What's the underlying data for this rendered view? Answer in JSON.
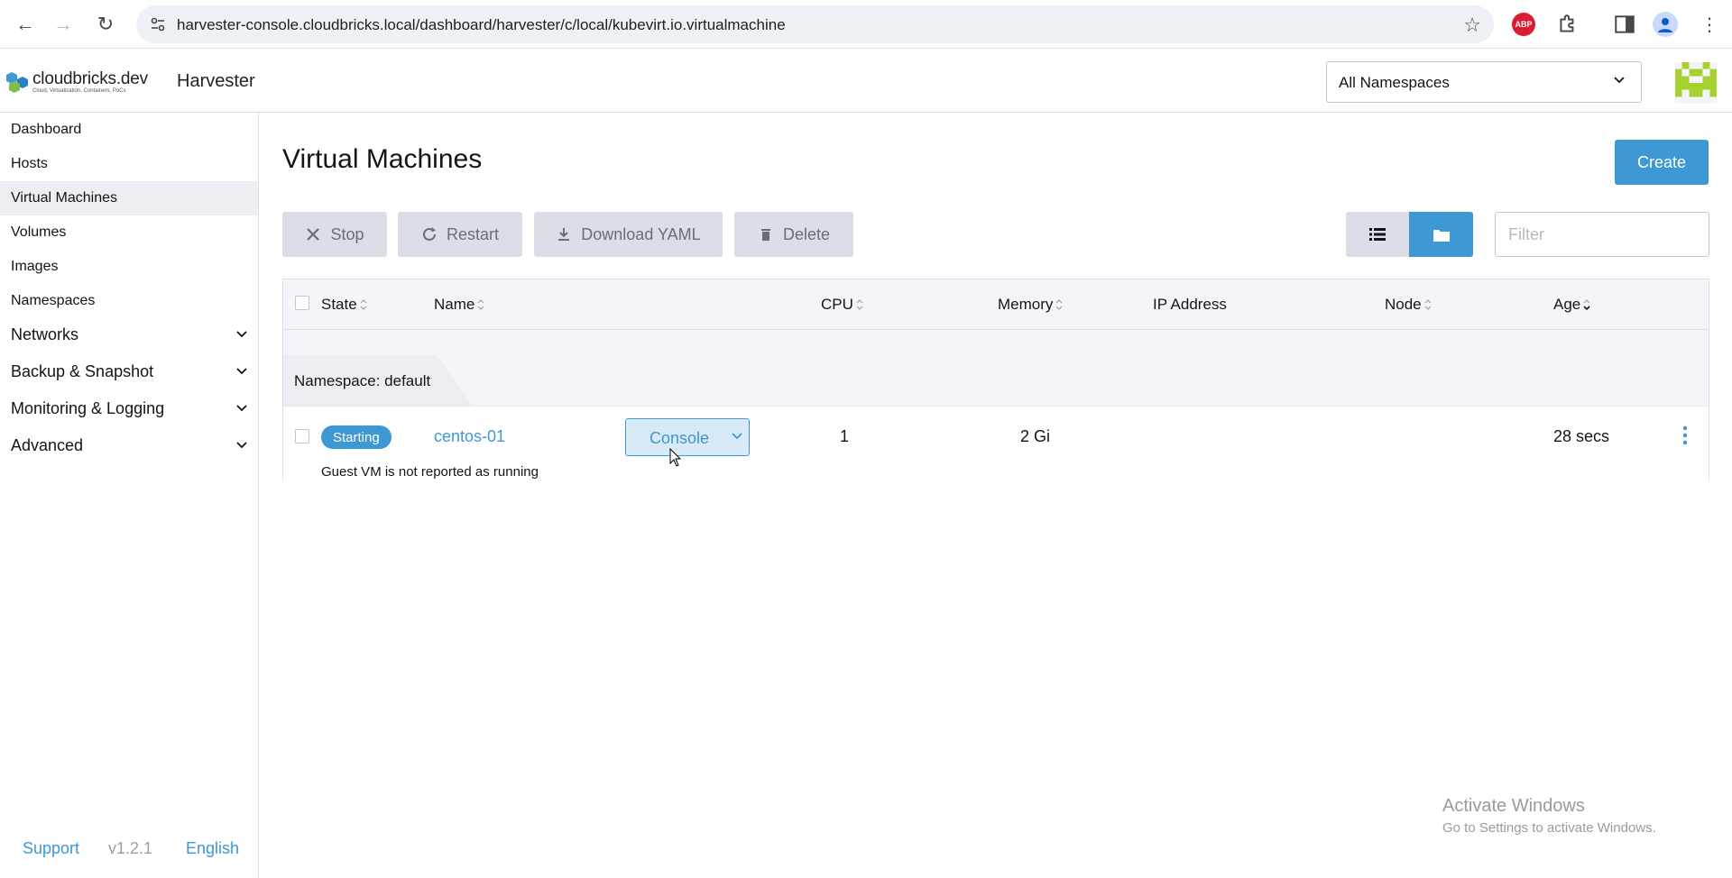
{
  "browser": {
    "url": "harvester-console.cloudbricks.local/dashboard/harvester/c/local/kubevirt.io.virtualmachine",
    "abp_label": "ABP"
  },
  "header": {
    "brand_name": "cloudbricks.dev",
    "brand_tagline": "Cloud, Virtualization, Containers, PoCs",
    "product": "Harvester",
    "namespace_selected": "All Namespaces"
  },
  "sidebar": {
    "items": [
      {
        "label": "Dashboard"
      },
      {
        "label": "Hosts"
      },
      {
        "label": "Virtual Machines"
      },
      {
        "label": "Volumes"
      },
      {
        "label": "Images"
      },
      {
        "label": "Namespaces"
      }
    ],
    "groups": [
      {
        "label": "Networks"
      },
      {
        "label": "Backup & Snapshot"
      },
      {
        "label": "Monitoring & Logging"
      },
      {
        "label": "Advanced"
      }
    ],
    "footer": {
      "support": "Support",
      "version": "v1.2.1",
      "language": "English"
    }
  },
  "main": {
    "title": "Virtual Machines",
    "create_label": "Create",
    "actions": {
      "stop": "Stop",
      "restart": "Restart",
      "download_yaml": "Download YAML",
      "delete": "Delete"
    },
    "filter_placeholder": "Filter"
  },
  "table": {
    "columns": {
      "state": "State",
      "name": "Name",
      "cpu": "CPU",
      "memory": "Memory",
      "ip": "IP Address",
      "node": "Node",
      "age": "Age"
    },
    "group": {
      "prefix": "Namespace:",
      "name": "default"
    },
    "rows": [
      {
        "state": "Starting",
        "name": "centos-01",
        "console_label": "Console",
        "cpu": "1",
        "memory": "2 Gi",
        "ip": "",
        "node": "",
        "age": "28 secs",
        "message": "Guest VM is not reported as running"
      }
    ]
  },
  "watermark": {
    "line1": "Activate Windows",
    "line2": "Go to Settings to activate Windows."
  },
  "colors": {
    "accent": "#3d98d3",
    "border": "#dcdee7",
    "header_bg": "#f4f5fa"
  }
}
